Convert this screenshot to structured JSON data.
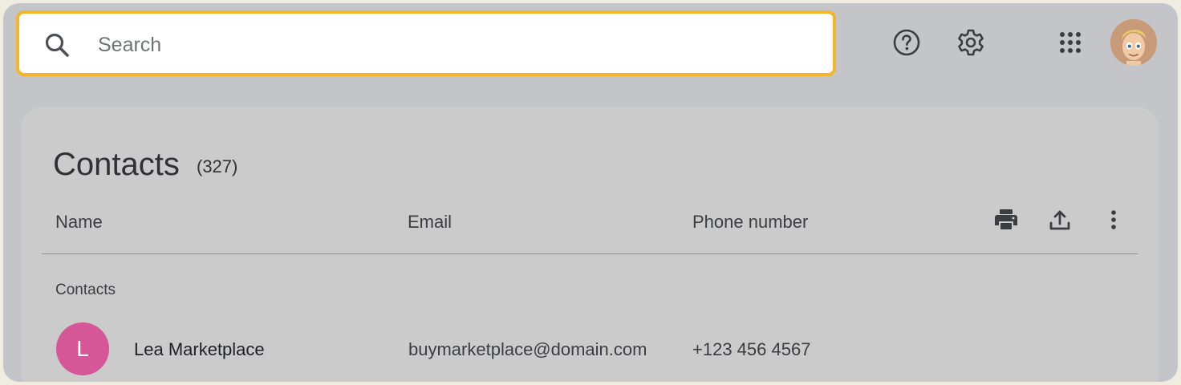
{
  "search": {
    "placeholder": "Search",
    "value": "",
    "icon": "search-icon",
    "highlight_color": "#f5b52a"
  },
  "header_icons": [
    "help-icon",
    "settings-icon",
    "apps-grid-icon",
    "account-avatar"
  ],
  "page": {
    "title": "Contacts",
    "count": "(327)"
  },
  "columns": {
    "name": "Name",
    "email": "Email",
    "phone": "Phone number"
  },
  "actions": [
    "print-icon",
    "export-icon",
    "more-options-icon"
  ],
  "section": {
    "label": "Contacts"
  },
  "contacts": [
    {
      "initial": "L",
      "name": "Lea Marketplace",
      "email": "buymarketplace@domain.com",
      "phone": "+123 456 4567",
      "avatar_color": "#d65797"
    }
  ],
  "colors": {
    "background": "#c4c5c8",
    "panel": "#cbcbcb",
    "text": "#303134"
  }
}
